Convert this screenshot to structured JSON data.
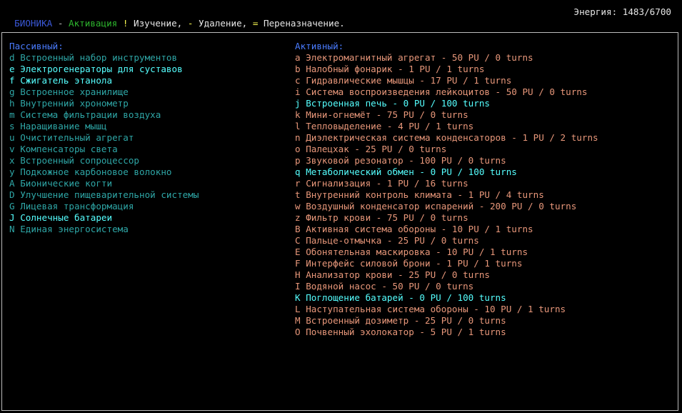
{
  "top_bar": {
    "title": "БИОНИКА",
    "sep": " - ",
    "mode": "Активация",
    "key1": "!",
    "text1": " Изучение, ",
    "key2": "-",
    "text2": " Удаление, ",
    "key3": "=",
    "text3": " Переназначение.",
    "energy": "Энергия: 1483/6700"
  },
  "colors": {
    "title": "#3a58d8",
    "mode": "#2db52d",
    "key": "#ffff54",
    "passive_item": "#2ea6a6",
    "passive_active_item": "#55ffff",
    "active_item": "#e8977a",
    "active_item_on": "#55ffff"
  },
  "passive": {
    "header": "Пассивный:",
    "items": [
      {
        "key": "d",
        "name": "Встроенный набор инструментов",
        "state": "dim"
      },
      {
        "key": "e",
        "name": "Электрогенераторы для суставов",
        "state": "bright"
      },
      {
        "key": "f",
        "name": "Сжигатель этанола",
        "state": "bright"
      },
      {
        "key": "g",
        "name": "Встроенное хранилище",
        "state": "dim"
      },
      {
        "key": "h",
        "name": "Внутренний хронометр",
        "state": "dim"
      },
      {
        "key": "m",
        "name": "Система фильтрации воздуха",
        "state": "dim"
      },
      {
        "key": "s",
        "name": "Наращивание мышц",
        "state": "dim"
      },
      {
        "key": "u",
        "name": "Очистительный агрегат",
        "state": "dim"
      },
      {
        "key": "v",
        "name": "Компенсаторы света",
        "state": "dim"
      },
      {
        "key": "x",
        "name": "Встроенный сопроцессор",
        "state": "dim"
      },
      {
        "key": "y",
        "name": "Подкожное карбоновое волокно",
        "state": "dim"
      },
      {
        "key": "A",
        "name": "Бионические когти",
        "state": "dim"
      },
      {
        "key": "D",
        "name": "Улучшение пищеварительной системы",
        "state": "dim"
      },
      {
        "key": "G",
        "name": "Лицевая трансформация",
        "state": "dim"
      },
      {
        "key": "J",
        "name": "Солнечные батареи",
        "state": "bright"
      },
      {
        "key": "N",
        "name": "Единая энергосистема",
        "state": "dim"
      }
    ]
  },
  "active": {
    "header": "Активный:",
    "items": [
      {
        "key": "a",
        "name": "Электромагнитный агрегат - 50 PU / 0 turns",
        "state": "off"
      },
      {
        "key": "b",
        "name": "Налобный фонарик - 1 PU / 1 turns",
        "state": "off"
      },
      {
        "key": "c",
        "name": "Гидравлические мышцы - 17 PU / 1 turns",
        "state": "off"
      },
      {
        "key": "i",
        "name": "Система воспроизведения лейкоцитов - 50 PU / 0 turns",
        "state": "off"
      },
      {
        "key": "j",
        "name": "Встроенная печь - 0 PU / 100 turns",
        "state": "on"
      },
      {
        "key": "k",
        "name": "Мини-огнемёт - 75 PU / 0 turns",
        "state": "off"
      },
      {
        "key": "l",
        "name": "Тепловыделение - 4 PU / 1 turns",
        "state": "off"
      },
      {
        "key": "n",
        "name": "Диэлектрическая система конденсаторов - 1 PU / 2 turns",
        "state": "off"
      },
      {
        "key": "o",
        "name": "Палецхак - 25 PU / 0 turns",
        "state": "off"
      },
      {
        "key": "p",
        "name": "Звуковой резонатор - 100 PU / 0 turns",
        "state": "off"
      },
      {
        "key": "q",
        "name": "Метаболический обмен - 0 PU / 100 turns",
        "state": "on"
      },
      {
        "key": "r",
        "name": "Сигнализация - 1 PU / 16 turns",
        "state": "off"
      },
      {
        "key": "t",
        "name": "Внутренний контроль климата - 1 PU / 4 turns",
        "state": "off"
      },
      {
        "key": "w",
        "name": "Воздушный конденсатор испарений - 200 PU / 0 turns",
        "state": "off"
      },
      {
        "key": "z",
        "name": "Фильтр крови - 75 PU / 0 turns",
        "state": "off"
      },
      {
        "key": "B",
        "name": "Активная система обороны - 10 PU / 1 turns",
        "state": "off"
      },
      {
        "key": "C",
        "name": "Пальце-отмычка - 25 PU / 0 turns",
        "state": "off"
      },
      {
        "key": "E",
        "name": "Обонятельная маскировка - 10 PU / 1 turns",
        "state": "off"
      },
      {
        "key": "F",
        "name": "Интерфейс силовой брони - 1 PU / 1 turns",
        "state": "off"
      },
      {
        "key": "H",
        "name": "Анализатор крови - 25 PU / 0 turns",
        "state": "off"
      },
      {
        "key": "I",
        "name": "Водяной насос - 50 PU / 0 turns",
        "state": "off"
      },
      {
        "key": "K",
        "name": "Поглощение батарей - 0 PU / 100 turns",
        "state": "on"
      },
      {
        "key": "L",
        "name": "Наступательная система обороны - 10 PU / 1 turns",
        "state": "off"
      },
      {
        "key": "M",
        "name": "Встроенный дозиметр - 25 PU / 0 turns",
        "state": "off"
      },
      {
        "key": "O",
        "name": "Почвенный эхолокатор - 5 PU / 1 turns",
        "state": "off"
      }
    ]
  }
}
